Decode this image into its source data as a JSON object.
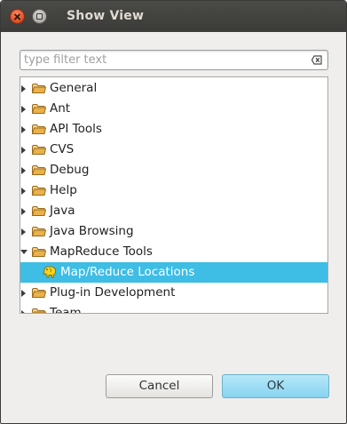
{
  "window": {
    "title": "Show View",
    "controls": [
      "close-icon",
      "maximize-icon"
    ]
  },
  "filter": {
    "placeholder": "type filter text",
    "value": "",
    "clear_icon": "clear-text-icon"
  },
  "tree": {
    "items": [
      {
        "label": "General",
        "expanded": false,
        "icon": "folder-icon"
      },
      {
        "label": "Ant",
        "expanded": false,
        "icon": "folder-icon"
      },
      {
        "label": "API Tools",
        "expanded": false,
        "icon": "folder-icon"
      },
      {
        "label": "CVS",
        "expanded": false,
        "icon": "folder-icon"
      },
      {
        "label": "Debug",
        "expanded": false,
        "icon": "folder-icon"
      },
      {
        "label": "Help",
        "expanded": false,
        "icon": "folder-icon"
      },
      {
        "label": "Java",
        "expanded": false,
        "icon": "folder-icon"
      },
      {
        "label": "Java Browsing",
        "expanded": false,
        "icon": "folder-icon"
      },
      {
        "label": "MapReduce Tools",
        "expanded": true,
        "icon": "folder-icon"
      },
      {
        "label": "Map/Reduce Locations",
        "child": true,
        "selected": true,
        "icon": "hadoop-elephant-icon"
      },
      {
        "label": "Plug-in Development",
        "expanded": false,
        "icon": "folder-icon"
      },
      {
        "label": "Team",
        "expanded": false,
        "icon": "folder-icon"
      }
    ]
  },
  "buttons": {
    "cancel": "Cancel",
    "ok": "OK"
  },
  "colors": {
    "titlebar": "#3d3d3a",
    "title_text": "#dfdbd2",
    "selection": "#3ebde5",
    "ok_button": "#9bdcf3",
    "folder": "#e9b24a"
  }
}
